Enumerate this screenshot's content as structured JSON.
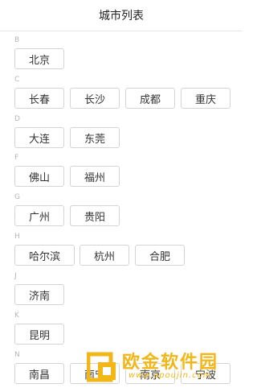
{
  "header": {
    "title": "城市列表"
  },
  "sections": [
    {
      "letter": "B",
      "cities": [
        "北京"
      ]
    },
    {
      "letter": "C",
      "cities": [
        "长春",
        "长沙",
        "成都",
        "重庆"
      ]
    },
    {
      "letter": "D",
      "cities": [
        "大连",
        "东莞"
      ]
    },
    {
      "letter": "F",
      "cities": [
        "佛山",
        "福州"
      ]
    },
    {
      "letter": "G",
      "cities": [
        "广州",
        "贵阳"
      ]
    },
    {
      "letter": "H",
      "cities": [
        "哈尔滨",
        "杭州",
        "合肥"
      ]
    },
    {
      "letter": "J",
      "cities": [
        "济南"
      ]
    },
    {
      "letter": "K",
      "cities": [
        "昆明"
      ]
    },
    {
      "letter": "N",
      "cities": [
        "南昌",
        "南宁",
        "南京",
        "宁波"
      ]
    }
  ],
  "watermark": {
    "text": "欧金软件园",
    "url": "www.apoujin.com"
  },
  "colors": {
    "border": "#d4d4d4",
    "letter": "#b5b5b5",
    "watermark": "#f2b617"
  }
}
